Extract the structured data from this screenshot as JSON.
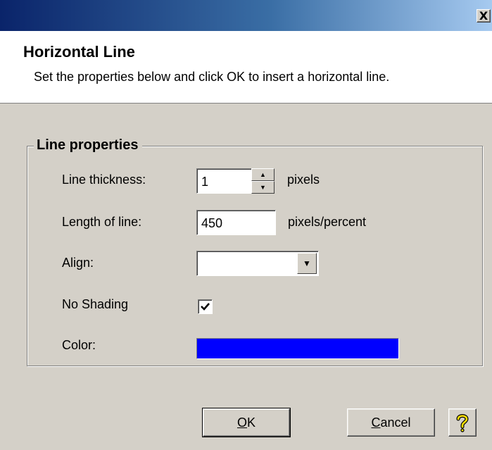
{
  "window": {
    "close_glyph": "X"
  },
  "header": {
    "title": "Horizontal Line",
    "description": "Set the properties below and click OK to insert a horizontal line."
  },
  "group": {
    "legend": "Line properties",
    "thickness": {
      "label": "Line thickness:",
      "value": "1",
      "unit": "pixels"
    },
    "length": {
      "label": "Length of line:",
      "value": "450",
      "unit": "pixels/percent"
    },
    "align": {
      "label": "Align:",
      "value": ""
    },
    "shading": {
      "label": "No Shading",
      "checked": true
    },
    "color": {
      "label": "Color:",
      "value": "#0000ff"
    }
  },
  "buttons": {
    "ok": {
      "mnemonic": "O",
      "rest": "K"
    },
    "cancel": {
      "mnemonic": "C",
      "rest": "ancel"
    },
    "help_icon": "question-icon"
  }
}
